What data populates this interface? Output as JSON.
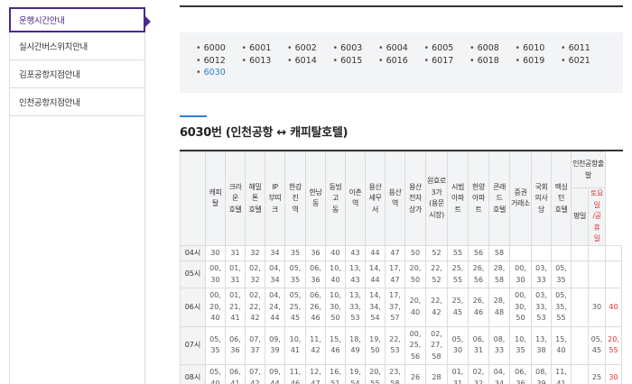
{
  "sidebar": {
    "items": [
      {
        "label": "운행시간안내",
        "active": true
      },
      {
        "label": "실시간버스위치안내",
        "active": false
      },
      {
        "label": "김포공항지점안내",
        "active": false
      },
      {
        "label": "인천공항지점안내",
        "active": false
      }
    ]
  },
  "routes": [
    "6000",
    "6001",
    "6002",
    "6003",
    "6004",
    "6005",
    "6008",
    "6010",
    "6011",
    "6012",
    "6013",
    "6014",
    "6015",
    "6016",
    "6017",
    "6018",
    "6019",
    "6021",
    "6030"
  ],
  "active_route": "6030",
  "title": "6030번 (인천공항 ↔ 캐피탈호텔)",
  "table": {
    "group_header": "인천공항출발",
    "headers": [
      "",
      "캐피탈",
      "크라운\n호텔",
      "해밀톤\n호텔",
      "IP\n부띠크",
      "한강진\n역",
      "한남동",
      "동빙고\n동",
      "이촌역",
      "용산\n세무서",
      "용산역",
      "용산\n전자\n상가",
      "원효로\n3가\n(용문\n시장)",
      "시범\n아파트",
      "한양\n아파트",
      "콘래드\n호텔",
      "증권\n거래소",
      "국회\n의사당",
      "렉싱턴\n호텔"
    ],
    "sub_headers": [
      "평일",
      "토요일\n/공휴\n일"
    ],
    "rows": [
      {
        "hour": "04시",
        "cells": [
          "30",
          "31",
          "32",
          "34",
          "35",
          "36",
          "40",
          "43",
          "44",
          "47",
          "50",
          "52",
          "55",
          "56",
          "58",
          "",
          "",
          "",
          ""
        ],
        "weekday": "",
        "holiday": ""
      },
      {
        "hour": "05시",
        "cells": [
          "00,\n30",
          "01,\n31",
          "02,\n32",
          "04,\n34",
          "05,\n35",
          "06,\n36",
          "10,\n40",
          "13,\n43",
          "14,\n44",
          "17,\n47",
          "20,\n50",
          "22,\n52",
          "25,\n55",
          "26,\n56",
          "28,\n58",
          "00,\n30",
          "03,\n33",
          "05,\n35",
          ""
        ],
        "weekday": "",
        "holiday": ""
      },
      {
        "hour": "06시",
        "cells": [
          "00,\n20,\n40",
          "01,\n21,\n41",
          "02,\n22,\n42",
          "04,\n24,\n44",
          "05,\n25,\n45",
          "06,\n26,\n46",
          "10,\n30,\n50",
          "13,\n33,\n53",
          "14,\n34,\n54",
          "17,\n37,\n57",
          "20,\n40",
          "22,\n42",
          "25,\n45",
          "26,\n46",
          "28,\n48",
          "00,\n30,\n50",
          "03,\n33,\n53",
          "05,\n35,\n55",
          ""
        ],
        "weekday": "30",
        "holiday": "40"
      },
      {
        "hour": "07시",
        "cells": [
          "05,\n35",
          "06,\n36",
          "07,\n37",
          "09,\n39",
          "10,\n41",
          "11,\n42",
          "15,\n46",
          "18,\n49",
          "19,\n50",
          "22,\n53",
          "00,\n25,\n56",
          "02,\n27,\n58",
          "05,\n30",
          "06,\n31",
          "08,\n33",
          "10,\n35",
          "13,\n38",
          "15,\n40",
          ""
        ],
        "weekday": "05,\n45",
        "holiday": "20,\n55"
      },
      {
        "hour": "08시",
        "cells": [
          "05,\n40",
          "06,\n41",
          "07,\n42",
          "09,\n44",
          "11,\n46",
          "12,\n47",
          "16,\n51",
          "19,\n54",
          "20,\n55",
          "23,\n58",
          "26",
          "28",
          "01,\n31",
          "02,\n32",
          "04,\n34",
          "06,\n36",
          "08,\n39",
          "11,\n41",
          ""
        ],
        "weekday": "25",
        "holiday": "30"
      }
    ]
  },
  "colors": {
    "accent": "#4a2a8c",
    "link_active": "#2a7fd4",
    "holiday": "#e03030"
  }
}
